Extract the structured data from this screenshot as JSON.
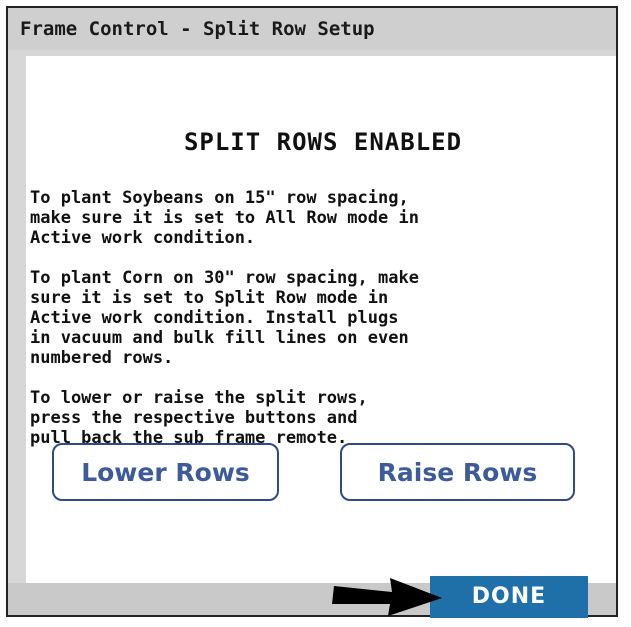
{
  "window": {
    "title": "Frame Control - Split Row Setup"
  },
  "content": {
    "heading": "SPLIT ROWS ENABLED",
    "paragraphs": [
      "To plant Soybeans on 15\" row spacing,\nmake sure it is set to All Row mode in\nActive work condition.",
      "To plant Corn on 30\" row spacing, make\nsure it is set to Split Row mode in\nActive work condition. Install plugs\nin vacuum and bulk fill lines on even\nnumbered rows.",
      "To lower or raise the split rows,\npress the respective buttons and\npull back the sub frame remote."
    ]
  },
  "buttons": {
    "lower_label": "Lower Rows",
    "raise_label": "Raise Rows",
    "done_label": "DONE"
  },
  "colors": {
    "button_border": "#2f4a8a",
    "button_text": "#3d5a99",
    "done_background": "#1f6fa8",
    "title_background": "#cfcfcf"
  },
  "icons": {
    "pointer": "arrow-right-icon"
  }
}
